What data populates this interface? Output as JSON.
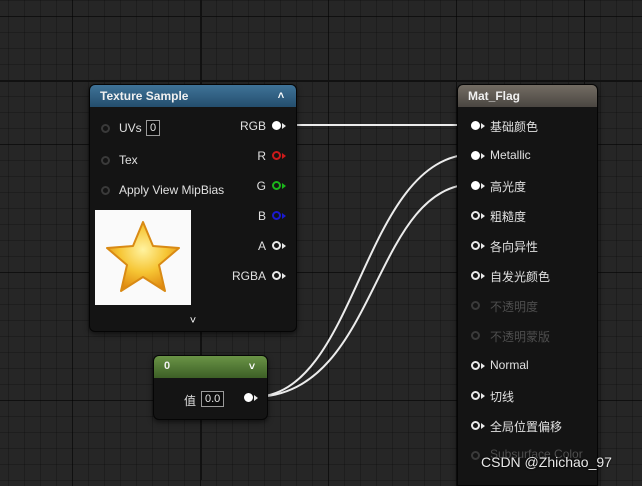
{
  "texture_node": {
    "title": "Texture Sample",
    "inputs": [
      {
        "label": "UVs",
        "value": "0"
      },
      {
        "label": "Tex"
      },
      {
        "label": "Apply View MipBias"
      }
    ],
    "outputs": [
      "RGB",
      "R",
      "G",
      "B",
      "A",
      "RGBA"
    ],
    "preview": "star-texture"
  },
  "constant_node": {
    "title": "0",
    "param_label": "值",
    "param_value": "0.0"
  },
  "material_node": {
    "title": "Mat_Flag",
    "inputs": [
      {
        "label": "基础颜色",
        "enabled": true
      },
      {
        "label": "Metallic",
        "enabled": true
      },
      {
        "label": "高光度",
        "enabled": true
      },
      {
        "label": "粗糙度",
        "enabled": true
      },
      {
        "label": "各向异性",
        "enabled": true
      },
      {
        "label": "自发光颜色",
        "enabled": true
      },
      {
        "label": "不透明度",
        "enabled": false
      },
      {
        "label": "不透明蒙版",
        "enabled": false
      },
      {
        "label": "Normal",
        "enabled": true
      },
      {
        "label": "切线",
        "enabled": true
      },
      {
        "label": "全局位置偏移",
        "enabled": true
      },
      {
        "label": "Subsurface Color",
        "enabled": false
      }
    ]
  },
  "watermark": "CSDN @Zhichao_97",
  "colors": {
    "texture_header": "#2f6288",
    "material_header": "#5e5852",
    "constant_header": "#557c36",
    "wire": "#ffffff",
    "pin_r": "#cc1a1a",
    "pin_g": "#1bb51b",
    "pin_b": "#1a1ad0"
  }
}
